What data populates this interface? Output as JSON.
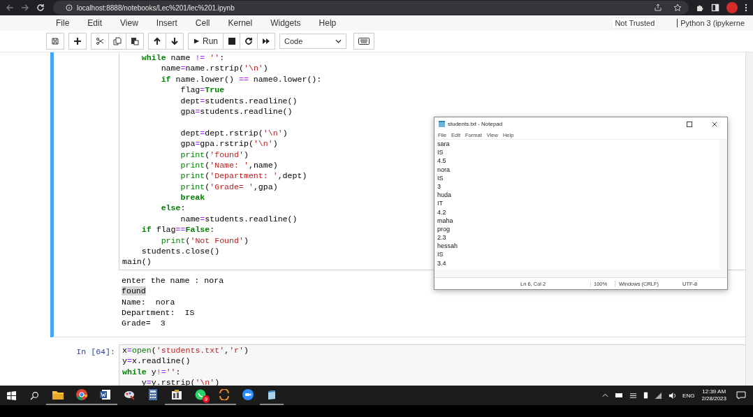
{
  "browser": {
    "url": "localhost:8888/notebooks/Lec%201/lec%201.ipynb"
  },
  "menu": [
    "File",
    "Edit",
    "View",
    "Insert",
    "Cell",
    "Kernel",
    "Widgets",
    "Help"
  ],
  "trust": "Not Trusted",
  "kernel": "Python 3 (ipykerne",
  "toolbar": {
    "run": "Run",
    "cell_type": "Code"
  },
  "cells": [
    {
      "selected": true,
      "lines": [
        {
          "tokens": [
            {
              "text": "    while",
              "kind": "keyword"
            },
            {
              "text": " name ",
              "kind": "plain"
            },
            {
              "text": "!=",
              "kind": "operator"
            },
            {
              "text": " ''",
              "kind": "string"
            },
            {
              "text": ":",
              "kind": "plain"
            }
          ]
        },
        {
          "tokens": [
            {
              "text": "        name",
              "kind": "plain"
            },
            {
              "text": "=",
              "kind": "operator"
            },
            {
              "text": "name.rstrip(",
              "kind": "plain"
            },
            {
              "text": "'\\n'",
              "kind": "string"
            },
            {
              "text": ")",
              "kind": "plain"
            }
          ]
        },
        {
          "tokens": [
            {
              "text": "        if",
              "kind": "keyword"
            },
            {
              "text": " name.lower() ",
              "kind": "plain"
            },
            {
              "text": "==",
              "kind": "operator"
            },
            {
              "text": " name0.lower():",
              "kind": "plain"
            }
          ]
        },
        {
          "tokens": [
            {
              "text": "            flag",
              "kind": "plain"
            },
            {
              "text": "=",
              "kind": "operator"
            },
            {
              "text": "True",
              "kind": "keyword"
            }
          ]
        },
        {
          "tokens": [
            {
              "text": "            dept",
              "kind": "plain"
            },
            {
              "text": "=",
              "kind": "operator"
            },
            {
              "text": "students.readline()",
              "kind": "plain"
            }
          ]
        },
        {
          "gap_after": true,
          "tokens": [
            {
              "text": "            gpa",
              "kind": "plain"
            },
            {
              "text": "=",
              "kind": "operator"
            },
            {
              "text": "students.readline()",
              "kind": "plain"
            }
          ]
        },
        {
          "tokens": [
            {
              "text": "            dept",
              "kind": "plain"
            },
            {
              "text": "=",
              "kind": "operator"
            },
            {
              "text": "dept.rstrip(",
              "kind": "plain"
            },
            {
              "text": "'\\n'",
              "kind": "string"
            },
            {
              "text": ")",
              "kind": "plain"
            }
          ]
        },
        {
          "tokens": [
            {
              "text": "            gpa",
              "kind": "plain"
            },
            {
              "text": "=",
              "kind": "operator"
            },
            {
              "text": "gpa.rstrip(",
              "kind": "plain"
            },
            {
              "text": "'\\n'",
              "kind": "string"
            },
            {
              "text": ")",
              "kind": "plain"
            }
          ]
        },
        {
          "tokens": [
            {
              "text": "            print",
              "kind": "builtin"
            },
            {
              "text": "(",
              "kind": "plain"
            },
            {
              "text": "'found'",
              "kind": "string"
            },
            {
              "text": ")",
              "kind": "plain"
            }
          ]
        },
        {
          "tokens": [
            {
              "text": "            print",
              "kind": "builtin"
            },
            {
              "text": "(",
              "kind": "plain"
            },
            {
              "text": "'Name: '",
              "kind": "string"
            },
            {
              "text": ",name)",
              "kind": "plain"
            }
          ]
        },
        {
          "tokens": [
            {
              "text": "            print",
              "kind": "builtin"
            },
            {
              "text": "(",
              "kind": "plain"
            },
            {
              "text": "'Department: '",
              "kind": "string"
            },
            {
              "text": ",dept)",
              "kind": "plain"
            }
          ]
        },
        {
          "tokens": [
            {
              "text": "            print",
              "kind": "builtin"
            },
            {
              "text": "(",
              "kind": "plain"
            },
            {
              "text": "'Grade= '",
              "kind": "string"
            },
            {
              "text": ",gpa)",
              "kind": "plain"
            }
          ]
        },
        {
          "tokens": [
            {
              "text": "            break",
              "kind": "keyword"
            }
          ]
        },
        {
          "tokens": [
            {
              "text": "        else",
              "kind": "keyword"
            },
            {
              "text": ":",
              "kind": "plain"
            }
          ]
        },
        {
          "tokens": [
            {
              "text": "            name",
              "kind": "plain"
            },
            {
              "text": "=",
              "kind": "operator"
            },
            {
              "text": "students.readline()",
              "kind": "plain"
            }
          ]
        },
        {
          "tokens": [
            {
              "text": "    if",
              "kind": "keyword"
            },
            {
              "text": " flag",
              "kind": "plain"
            },
            {
              "text": "==",
              "kind": "operator"
            },
            {
              "text": "False",
              "kind": "keyword"
            },
            {
              "text": ":",
              "kind": "plain"
            }
          ]
        },
        {
          "tokens": [
            {
              "text": "        print",
              "kind": "builtin"
            },
            {
              "text": "(",
              "kind": "plain"
            },
            {
              "text": "'Not Found'",
              "kind": "string"
            },
            {
              "text": ")",
              "kind": "plain"
            }
          ]
        },
        {
          "tokens": [
            {
              "text": "    students.close()",
              "kind": "plain"
            }
          ]
        },
        {
          "tokens": [
            {
              "text": "main()",
              "kind": "plain"
            }
          ]
        }
      ],
      "output": [
        {
          "text": "enter the name : nora",
          "highlighted": false
        },
        {
          "text": "found",
          "highlighted": true
        },
        {
          "text": "Name:  nora",
          "highlighted": false
        },
        {
          "text": "Department:  IS",
          "highlighted": false
        },
        {
          "text": "Grade=  3",
          "highlighted": false
        }
      ]
    },
    {
      "selected": false,
      "prompt": "In [64]:",
      "lines": [
        {
          "tokens": [
            {
              "text": "x",
              "kind": "plain"
            },
            {
              "text": "=",
              "kind": "operator"
            },
            {
              "text": "open",
              "kind": "builtin"
            },
            {
              "text": "(",
              "kind": "plain"
            },
            {
              "text": "'students.txt'",
              "kind": "string"
            },
            {
              "text": ",",
              "kind": "plain"
            },
            {
              "text": "'r'",
              "kind": "string"
            },
            {
              "text": ")",
              "kind": "plain"
            }
          ]
        },
        {
          "tokens": [
            {
              "text": "y",
              "kind": "plain"
            },
            {
              "text": "=",
              "kind": "operator"
            },
            {
              "text": "x.readline()",
              "kind": "plain"
            }
          ]
        },
        {
          "tokens": [
            {
              "text": "while",
              "kind": "keyword"
            },
            {
              "text": " y",
              "kind": "plain"
            },
            {
              "text": "!=",
              "kind": "operator"
            },
            {
              "text": "''",
              "kind": "string"
            },
            {
              "text": ":",
              "kind": "plain"
            }
          ]
        },
        {
          "tokens": [
            {
              "text": "    y",
              "kind": "plain"
            },
            {
              "text": "=",
              "kind": "operator"
            },
            {
              "text": "y.rstrip(",
              "kind": "plain"
            },
            {
              "text": "'\\n'",
              "kind": "string"
            },
            {
              "text": ")",
              "kind": "plain"
            }
          ]
        }
      ]
    }
  ],
  "notepad": {
    "title": "students.txt - Notepad",
    "menu": [
      "File",
      "Edit",
      "Format",
      "View",
      "Help"
    ],
    "lines": [
      "sara",
      "IS",
      "4.5",
      "nora",
      "IS",
      "3",
      "huda",
      "IT",
      "4.2",
      "maha",
      "prog",
      "2.3",
      "hessah",
      "IS",
      "3.4"
    ],
    "status": [
      "Ln 6, Col 2",
      "100%",
      "Windows (CRLF)",
      "UTF-8"
    ]
  },
  "taskbar": {
    "apps": [
      {
        "kind": "folder",
        "running": true
      },
      {
        "kind": "browser",
        "running": true
      },
      {
        "kind": "document",
        "running": true
      },
      {
        "kind": "paint",
        "running": false
      },
      {
        "kind": "calculator",
        "running": false
      },
      {
        "kind": "app",
        "running": true
      },
      {
        "kind": "chat",
        "running": true,
        "badge": "9"
      },
      {
        "kind": "sync",
        "running": true
      },
      {
        "kind": "video",
        "running": false
      },
      {
        "kind": "notepad",
        "running": true
      }
    ],
    "lang": "ENG",
    "time": "12:39 AM",
    "date": "2/28/2023"
  }
}
